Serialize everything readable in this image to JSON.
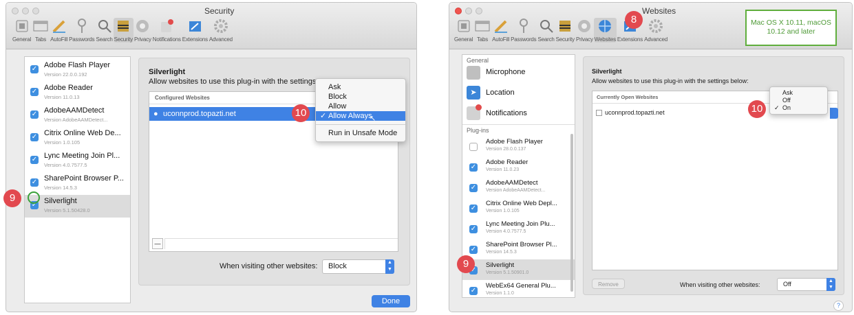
{
  "left": {
    "title": "Security",
    "toolbar": [
      "General",
      "Tabs",
      "AutoFill",
      "Passwords",
      "Search",
      "Security",
      "Privacy",
      "Notifications",
      "Extensions",
      "Advanced"
    ],
    "plugins": [
      {
        "name": "Adobe Flash Player",
        "version": "Version 22.0.0.192"
      },
      {
        "name": "Adobe Reader",
        "version": "Version 11.0.13"
      },
      {
        "name": "AdobeAAMDetect",
        "version": "Version AdobeAAMDetect..."
      },
      {
        "name": "Citrix Online Web De...",
        "version": "Version 1.0.105"
      },
      {
        "name": "Lync Meeting Join Pl...",
        "version": "Version 4.0.7577.5"
      },
      {
        "name": "SharePoint Browser P...",
        "version": "Version 14.5.3"
      },
      {
        "name": "Silverlight",
        "version": "Version 5.1.50428.0"
      }
    ],
    "panel_title": "Silverlight",
    "panel_desc": "Allow websites to use this plug-in with the settings below:",
    "table_header": "Configured Websites",
    "website": "uconnprod.topazti.net",
    "menu": {
      "items": [
        "Ask",
        "Block",
        "Allow",
        "Allow Always"
      ],
      "selected": "Allow Always",
      "extra": "Run in Unsafe Mode"
    },
    "visiting_label": "When visiting other websites:",
    "visiting_value": "Block",
    "minus": "—",
    "done": "Done",
    "badge_row": "9",
    "badge_menu": "10"
  },
  "right": {
    "title": "Websites",
    "toolbar": [
      "General",
      "Tabs",
      "AutoFill",
      "Passwords",
      "Search",
      "Security",
      "Privacy",
      "Websites",
      "Extensions",
      "Advanced"
    ],
    "section_general": "General",
    "general_items": [
      "Microphone",
      "Location",
      "Notifications"
    ],
    "section_plugins": "Plug-ins",
    "plugins": [
      {
        "name": "Adobe Flash Player",
        "version": "Version 28.0.0.137",
        "checked": false
      },
      {
        "name": "Adobe Reader",
        "version": "Version 11.0.23",
        "checked": true
      },
      {
        "name": "AdobeAAMDetect",
        "version": "Version AdobeAAMDetect...",
        "checked": true
      },
      {
        "name": "Citrix Online Web Depl...",
        "version": "Version 1.0.105",
        "checked": true
      },
      {
        "name": "Lync Meeting Join Plu...",
        "version": "Version 4.0.7577.5",
        "checked": true
      },
      {
        "name": "SharePoint Browser Pl...",
        "version": "Version 14.5.3",
        "checked": true
      },
      {
        "name": "Silverlight",
        "version": "Version 5.1.50901.0",
        "checked": true
      },
      {
        "name": "WebEx64 General Plu...",
        "version": "Version 1.1.0",
        "checked": true
      }
    ],
    "panel_title": "Silverlight",
    "panel_desc": "Allow websites to use this plug-in with the settings below:",
    "table_header": "Currently Open Websites",
    "website": "uconnprod.topazti.net",
    "menu": {
      "items": [
        "Ask",
        "Off",
        "On"
      ],
      "selected": "On"
    },
    "remove": "Remove",
    "visiting_label": "When visiting other websites:",
    "visiting_value": "Off",
    "help": "?",
    "note": "Mac OS X 10.11, macOS 10.12 and later",
    "badge_toolbar": "8",
    "badge_row": "9",
    "badge_menu": "10"
  }
}
